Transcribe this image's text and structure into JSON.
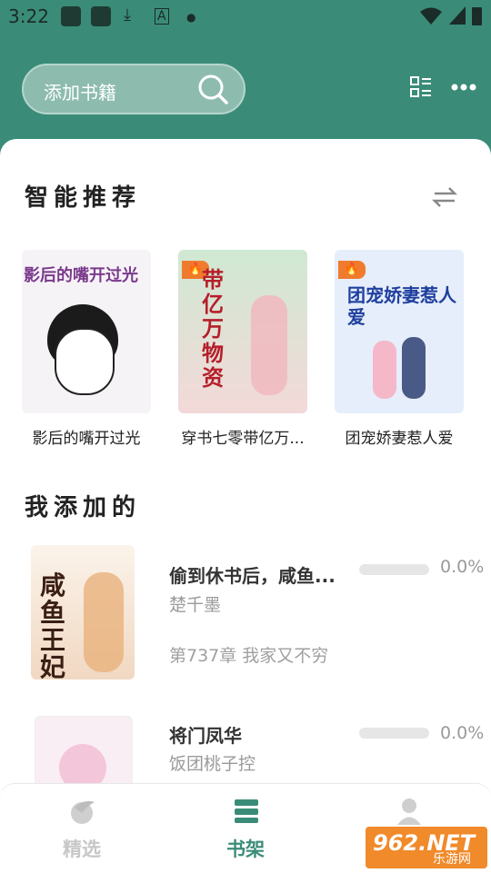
{
  "status_bar": {
    "time": "3:22"
  },
  "header": {
    "search_placeholder": "添加书籍"
  },
  "recommend": {
    "title": "智能推荐",
    "books": [
      {
        "title": "影后的嘴开过光",
        "cover_text": "影后的嘴开过光"
      },
      {
        "title": "穿书七零带亿万...",
        "cover_text": "带亿万物资"
      },
      {
        "title": "团宠娇妻惹人爱",
        "cover_text": "团宠娇妻惹人爱"
      }
    ]
  },
  "added": {
    "title": "我添加的",
    "books": [
      {
        "title": "偷到休书后，咸鱼...",
        "author": "楚千墨",
        "chapter": "第737章 我家又不穷",
        "progress": "0.0%",
        "progress_value": 0.0,
        "cover_text": "咸鱼王妃"
      },
      {
        "title": "将门凤华",
        "author": "饭团桃子控",
        "progress": "0.0%",
        "progress_value": 0.0
      }
    ]
  },
  "tabbar": {
    "tabs": [
      {
        "label": "精选",
        "active": false
      },
      {
        "label": "书架",
        "active": true
      },
      {
        "label": "",
        "active": false
      }
    ]
  },
  "watermark": {
    "text": "962.NET",
    "sub": "乐游网"
  },
  "colors": {
    "brand": "#3a8c78",
    "fire": "#f07b2e"
  }
}
